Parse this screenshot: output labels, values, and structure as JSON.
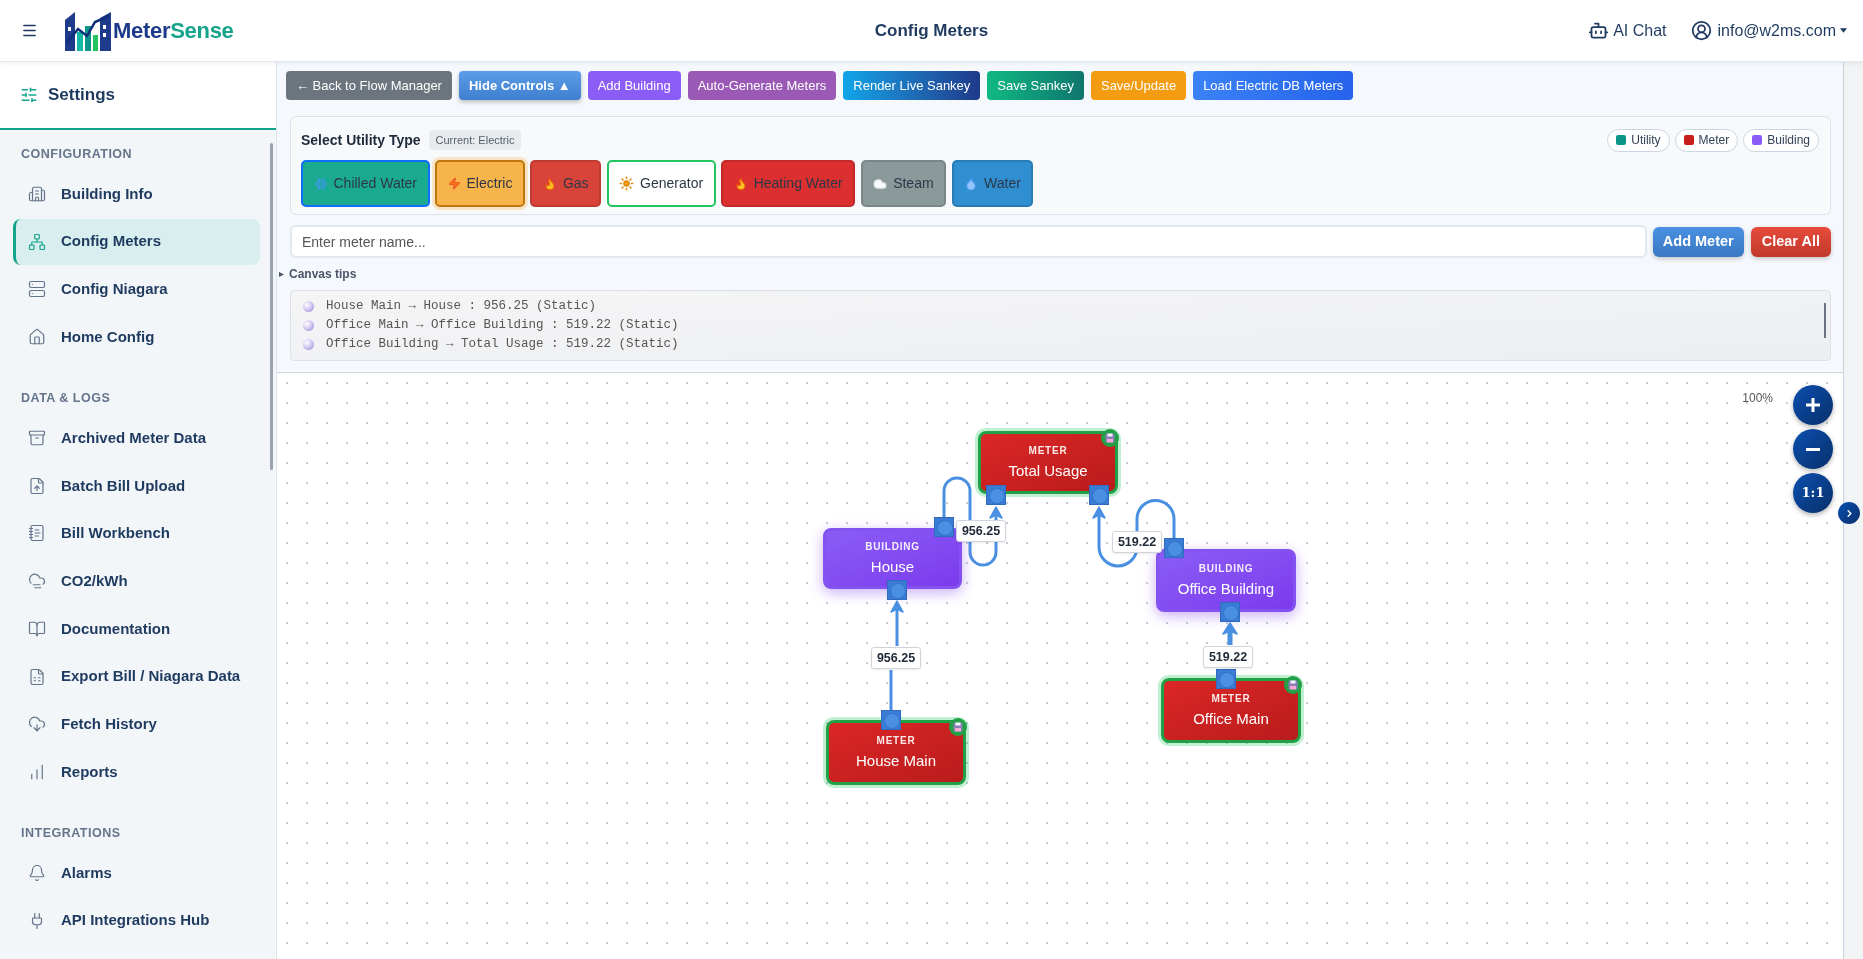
{
  "header": {
    "brand": {
      "first": "Meter",
      "second": "Sense"
    },
    "title": "Config Meters",
    "ai_chat": "AI Chat",
    "user": "info@w2ms.com"
  },
  "sidebar": {
    "title": "Settings",
    "sections": [
      {
        "heading": "CONFIGURATION",
        "items": [
          {
            "label": "Building Info",
            "selected": false
          },
          {
            "label": "Config Meters",
            "selected": true
          },
          {
            "label": "Config Niagara",
            "selected": false
          },
          {
            "label": "Home Config",
            "selected": false
          }
        ]
      },
      {
        "heading": "DATA & LOGS",
        "items": [
          {
            "label": "Archived Meter Data",
            "selected": false
          },
          {
            "label": "Batch Bill Upload",
            "selected": false
          },
          {
            "label": "Bill Workbench",
            "selected": false
          },
          {
            "label": "CO2/kWh",
            "selected": false
          },
          {
            "label": "Documentation",
            "selected": false
          },
          {
            "label": "Export Bill / Niagara Data",
            "selected": false
          },
          {
            "label": "Fetch History",
            "selected": false
          },
          {
            "label": "Reports",
            "selected": false
          }
        ]
      },
      {
        "heading": "INTEGRATIONS",
        "items": [
          {
            "label": "Alarms",
            "selected": false
          },
          {
            "label": "API Integrations Hub",
            "selected": false
          }
        ]
      }
    ]
  },
  "toolbar": [
    "← Back to Flow Manager",
    "Hide Controls ▲",
    "Add Building",
    "Auto-Generate Meters",
    "Render Live Sankey",
    "Save Sankey",
    "Save/Update",
    "Load Electric DB Meters"
  ],
  "utility_panel": {
    "title": "Select Utility Type",
    "current": "Current: Electric",
    "legend": [
      {
        "label": "Utility",
        "color": "#0d9488"
      },
      {
        "label": "Meter",
        "color": "#c81e1e"
      },
      {
        "label": "Building",
        "color": "#8b5cf6"
      }
    ],
    "utilities": [
      {
        "label": "Chilled Water",
        "kind": "filled",
        "color": "#1aaa8f",
        "selected": false,
        "focused": true
      },
      {
        "label": "Electric",
        "kind": "filled",
        "color": "#f6b44b",
        "selected": true,
        "focused": false
      },
      {
        "label": "Gas",
        "kind": "filled",
        "color": "#d9443a",
        "selected": false,
        "focused": false
      },
      {
        "label": "Generator",
        "kind": "outline",
        "color": "#22c55e",
        "selected": false,
        "focused": false
      },
      {
        "label": "Heating Water",
        "kind": "filled",
        "color": "#dc2f2f",
        "selected": false,
        "focused": false
      },
      {
        "label": "Steam",
        "kind": "filled",
        "color": "#8a9a9b",
        "selected": false,
        "focused": false
      },
      {
        "label": "Water",
        "kind": "filled",
        "color": "#2f8fd0",
        "selected": false,
        "focused": false
      }
    ]
  },
  "meter_input": {
    "placeholder": "Enter meter name...",
    "add_button": "Add Meter",
    "clear_button": "Clear All"
  },
  "canvas_tips": {
    "label": "Canvas tips",
    "expanded": false
  },
  "flow_log": [
    "House Main → House : 956.25 (Static)",
    "Office Main → Office Building : 519.22 (Static)",
    "Office Building → Total Usage : 519.22 (Static)"
  ],
  "canvas": {
    "zoom_level": "100%",
    "reset_zoom": "1:1",
    "nodes": [
      {
        "kind": "meter",
        "type_label": "METER",
        "name": "Total Usage",
        "saved": true
      },
      {
        "kind": "building",
        "type_label": "BUILDING",
        "name": "House",
        "saved": false
      },
      {
        "kind": "building",
        "type_label": "BUILDING",
        "name": "Office Building",
        "saved": false
      },
      {
        "kind": "meter",
        "type_label": "METER",
        "name": "Office Main",
        "saved": true
      },
      {
        "kind": "meter",
        "type_label": "METER",
        "name": "House Main",
        "saved": true
      }
    ],
    "edges": [
      {
        "label": "956.25"
      },
      {
        "label": "519.22"
      },
      {
        "label": "956.25"
      },
      {
        "label": "519.22"
      }
    ]
  }
}
